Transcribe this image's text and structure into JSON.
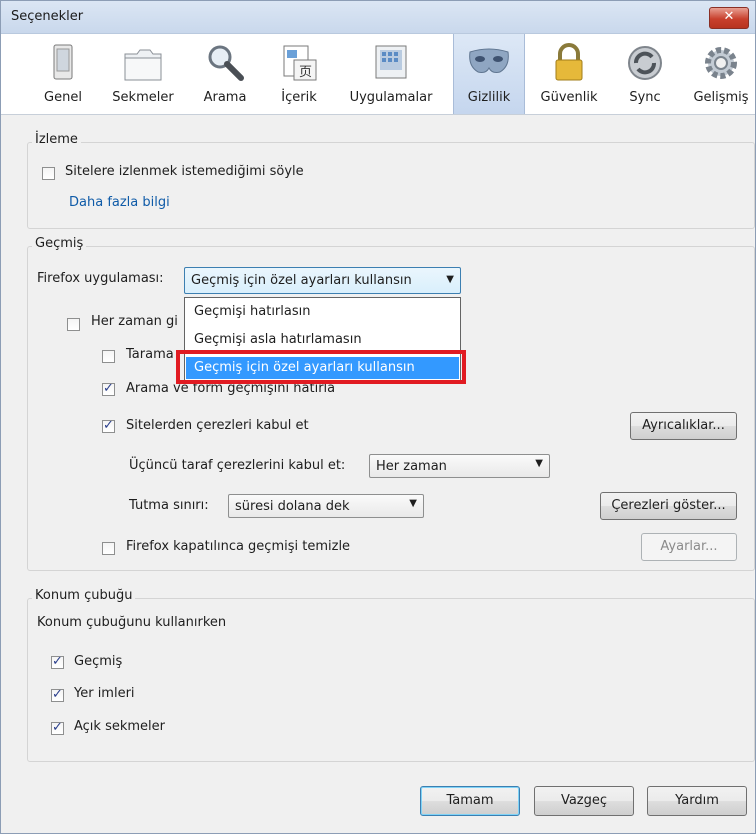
{
  "window": {
    "title": "Seçenekler",
    "close_glyph": "✕"
  },
  "toolbar": {
    "items": [
      {
        "label": "Genel",
        "icon": "general-icon"
      },
      {
        "label": "Sekmeler",
        "icon": "tabs-icon"
      },
      {
        "label": "Arama",
        "icon": "search-icon"
      },
      {
        "label": "İçerik",
        "icon": "content-icon"
      },
      {
        "label": "Uygulamalar",
        "icon": "applications-icon"
      },
      {
        "label": "Gizlilik",
        "icon": "privacy-mask-icon",
        "selected": true
      },
      {
        "label": "Güvenlik",
        "icon": "padlock-icon"
      },
      {
        "label": "Sync",
        "icon": "sync-icon"
      },
      {
        "label": "Gelişmiş",
        "icon": "gear-icon"
      }
    ]
  },
  "tracking": {
    "title": "İzleme",
    "dnt_label": "Sitelere izlenmek istemediğimi söyle",
    "dnt_checked": false,
    "more_info": "Daha fazla bilgi"
  },
  "history": {
    "title": "Geçmiş",
    "firefox_will_label": "Firefox uygulaması:",
    "mode_value": "Geçmiş için özel ayarları kullansın",
    "options": [
      "Geçmişi hatırlasın",
      "Geçmişi asla hatırlamasın",
      "Geçmiş için özel ayarları kullansın"
    ],
    "private_label": "Her zaman gi",
    "private_checked": false,
    "browsing_label": "Tarama",
    "browsing_checked": false,
    "search_form_label": "Arama ve form geçmişini hatırla",
    "search_form_checked": true,
    "cookies_label": "Sitelerden çerezleri kabul et",
    "cookies_checked": true,
    "exceptions_button": "Ayrıcalıklar...",
    "third_party_label": "Üçüncü taraf çerezlerini kabul et:",
    "third_party_value": "Her zaman",
    "keep_until_label": "Tutma sınırı:",
    "keep_until_value": "süresi dolana dek",
    "show_cookies_button": "Çerezleri göster...",
    "clear_on_close_label": "Firefox kapatılınca geçmişi temizle",
    "clear_on_close_checked": false,
    "settings_button": "Ayarlar..."
  },
  "location_bar": {
    "title": "Konum çubuğu",
    "when_using_label": "Konum çubuğunu kullanırken",
    "history_label": "Geçmiş",
    "history_checked": true,
    "bookmarks_label": "Yer imleri",
    "bookmarks_checked": true,
    "open_tabs_label": "Açık sekmeler",
    "open_tabs_checked": true
  },
  "footer": {
    "ok": "Tamam",
    "cancel": "Vazgeç",
    "help": "Yardım"
  },
  "colors": {
    "highlight": "#e11b22",
    "selection": "#3399ff",
    "link": "#0f5ba8"
  }
}
